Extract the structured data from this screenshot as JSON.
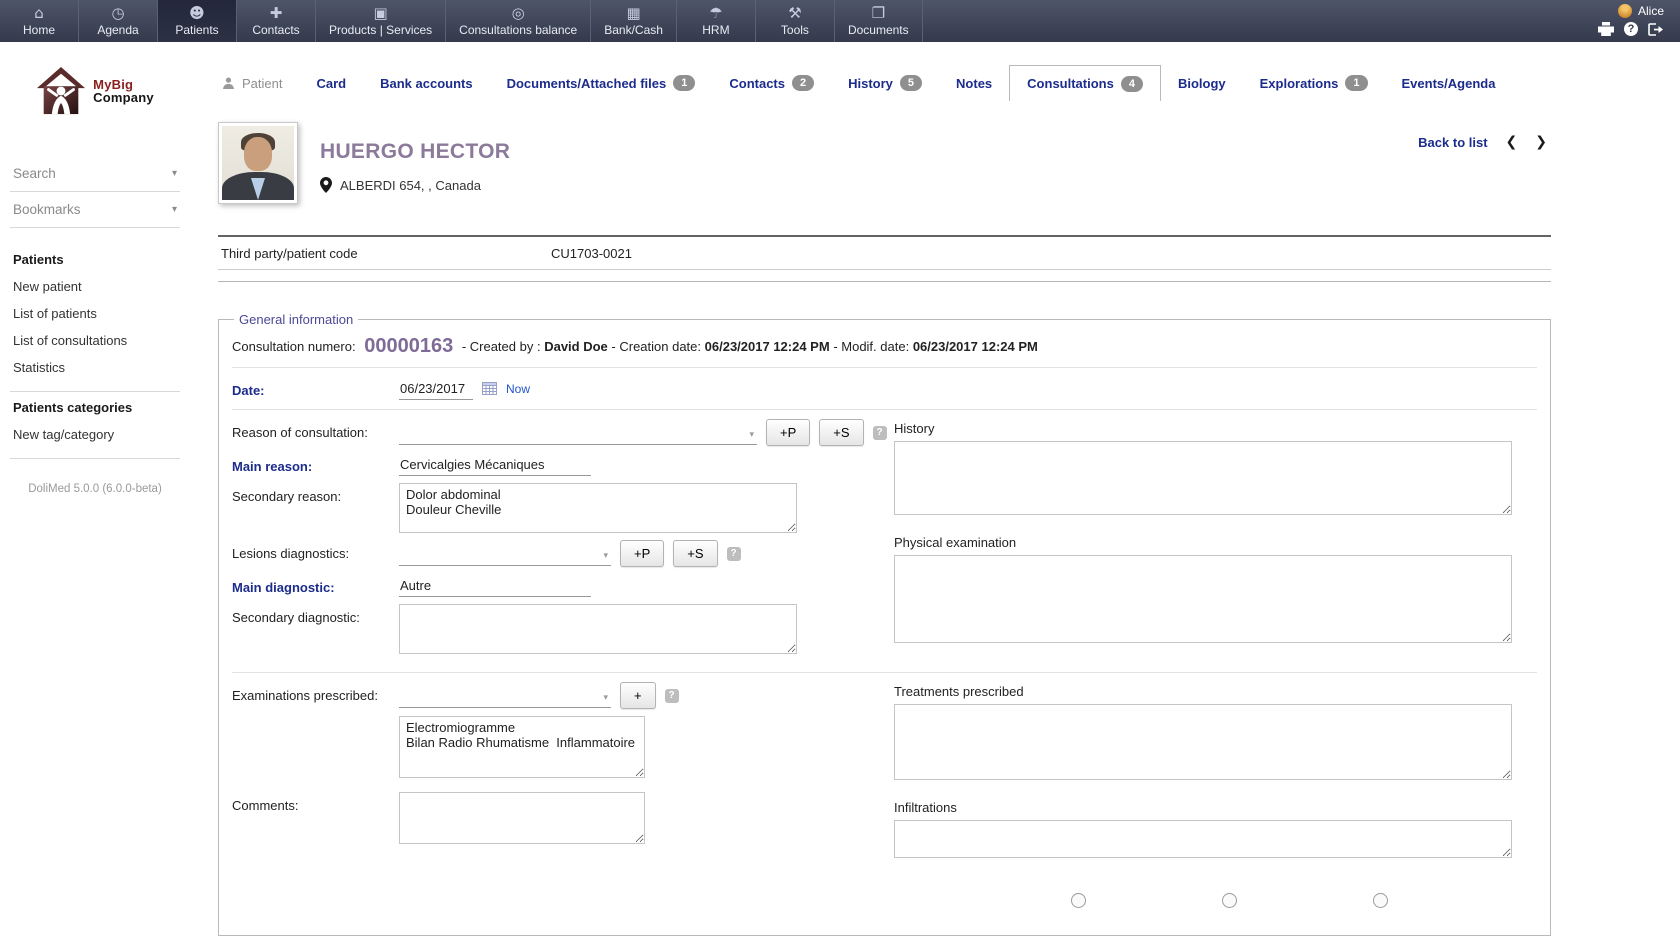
{
  "colors": {
    "nav_bg": "#3d4254",
    "accent_navy": "#1c2c8c",
    "accent_purple": "#8c7a9b",
    "legend_purple": "#4d4796",
    "badge_gray": "#8f8f8f"
  },
  "topnav": {
    "items": [
      {
        "label": "Home",
        "icon": "⌂"
      },
      {
        "label": "Agenda",
        "icon": "◷"
      },
      {
        "label": "Patients",
        "icon": "☻"
      },
      {
        "label": "Contacts",
        "icon": "✚"
      },
      {
        "label": "Products | Services",
        "icon": "▣"
      },
      {
        "label": "Consultations balance",
        "icon": "◎"
      },
      {
        "label": "Bank/Cash",
        "icon": "▦"
      },
      {
        "label": "HRM",
        "icon": "☂"
      },
      {
        "label": "Tools",
        "icon": "⚒"
      },
      {
        "label": "Documents",
        "icon": "❐"
      }
    ],
    "user": {
      "name": "Alice"
    }
  },
  "sidebar": {
    "logo_line1": "MyBig",
    "logo_line2": "Company",
    "search_label": "Search",
    "bookmarks_label": "Bookmarks",
    "menu": {
      "patients_title": "Patients",
      "patients_items": [
        "New patient",
        "List of patients",
        "List of consultations",
        "Statistics"
      ],
      "categories_title": "Patients categories",
      "categories_items": [
        "New tag/category"
      ]
    },
    "version": "DoliMed 5.0.0 (6.0.0-beta)"
  },
  "tabs": [
    {
      "label": "Patient"
    },
    {
      "label": "Card"
    },
    {
      "label": "Bank accounts"
    },
    {
      "label": "Documents/Attached files",
      "badge": "1"
    },
    {
      "label": "Contacts",
      "badge": "2"
    },
    {
      "label": "History",
      "badge": "5"
    },
    {
      "label": "Notes"
    },
    {
      "label": "Consultations",
      "badge": "4"
    },
    {
      "label": "Biology"
    },
    {
      "label": "Explorations",
      "badge": "1"
    },
    {
      "label": "Events/Agenda"
    }
  ],
  "patient": {
    "name": "HUERGO HECTOR",
    "address": "ALBERDI 654, , Canada",
    "back_to_list": "Back to list",
    "prev_icon": "❮",
    "next_icon": "❯"
  },
  "details": {
    "code_label": "Third party/patient code",
    "code_value": "CU1703-0021"
  },
  "general": {
    "legend": "General information",
    "numero_label": "Consultation numero:",
    "numero": "00000163",
    "created_by_sep": "- Created by :",
    "created_by": "David Doe",
    "creation_sep": "- Creation date:",
    "creation_date": "06/23/2017 12:24 PM",
    "modif_sep": "- Modif. date:",
    "modif_date": "06/23/2017 12:24 PM"
  },
  "form": {
    "date_label": "Date:",
    "date_value": "06/23/2017",
    "now_link": "Now",
    "reason_label": "Reason of consultation:",
    "btn_p": "+P",
    "btn_s": "+S",
    "btn_plus": "+",
    "main_reason_label": "Main reason:",
    "main_reason_value": "Cervicalgies Mécaniques",
    "secondary_reason_label": "Secondary reason:",
    "secondary_reason_value": "Dolor abdominal\nDouleur Cheville",
    "lesions_label": "Lesions diagnostics:",
    "main_diagnostic_label": "Main diagnostic:",
    "main_diagnostic_value": "Autre",
    "secondary_diagnostic_label": "Secondary diagnostic:",
    "secondary_diagnostic_value": "",
    "examinations_label": "Examinations prescribed:",
    "examinations_value": "Electromiogramme\nBilan Radio Rhumatisme  Inflammatoire",
    "comments_label": "Comments:",
    "comments_value": "",
    "history_label": "History",
    "physical_label": "Physical examination",
    "treatments_label": "Treatments prescribed",
    "infiltrations_label": "Infiltrations"
  }
}
